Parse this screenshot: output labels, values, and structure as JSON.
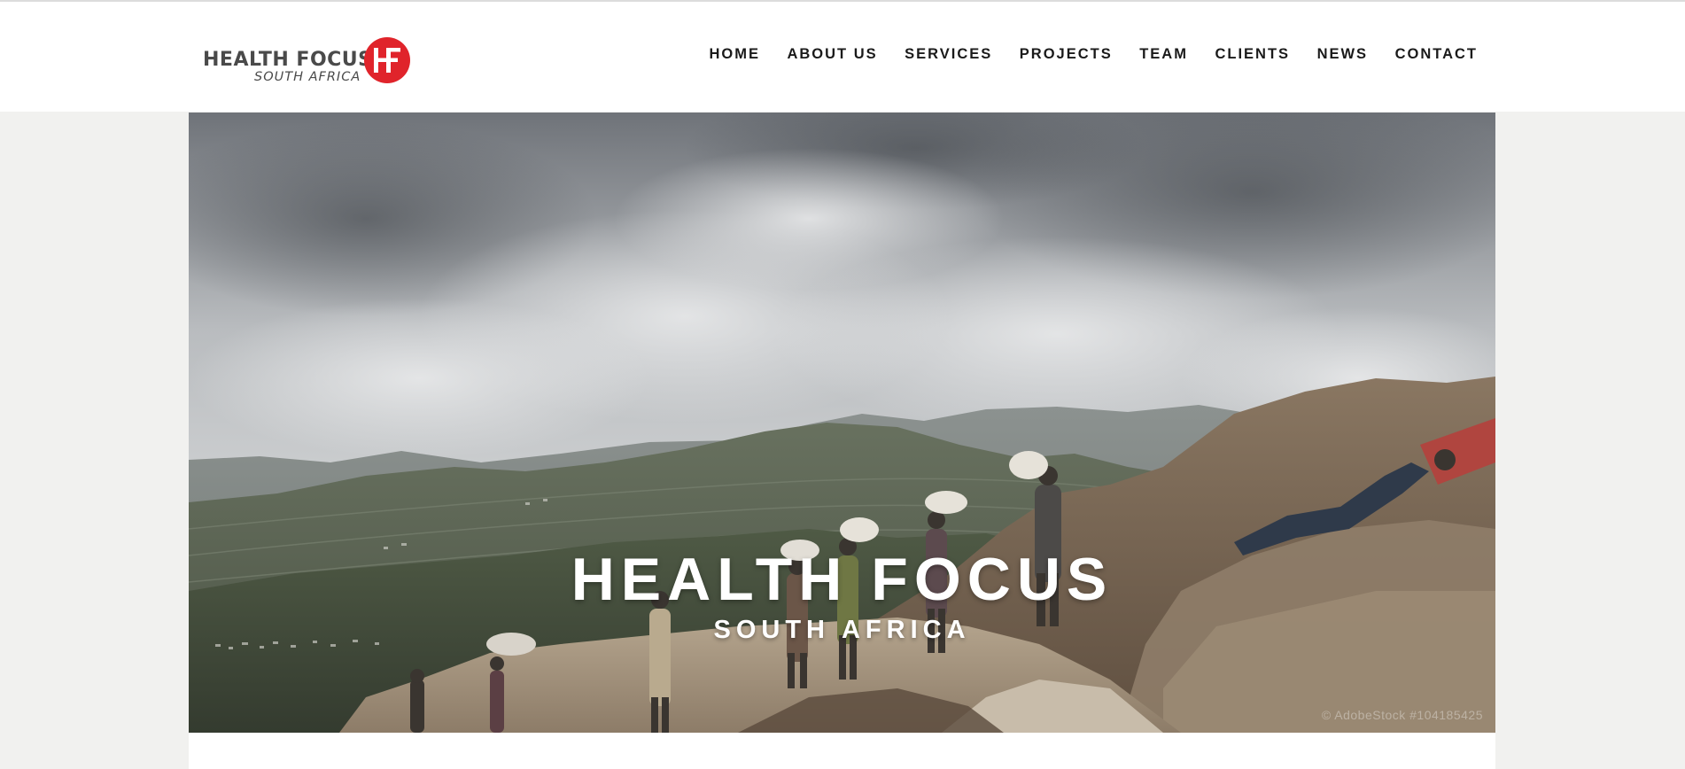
{
  "logo": {
    "line1": "HEALTH FOCUS",
    "line2": "SOUTH AFRICA",
    "mark_color": "#e0242b"
  },
  "nav": {
    "items": [
      "HOME",
      "ABOUT US",
      "SERVICES",
      "PROJECTS",
      "TEAM",
      "CLIENTS",
      "NEWS",
      "CONTACT"
    ]
  },
  "hero": {
    "title": "HEALTH FOCUS",
    "subtitle": "SOUTH AFRICA",
    "credit": "© AdobeStock #104185425"
  }
}
